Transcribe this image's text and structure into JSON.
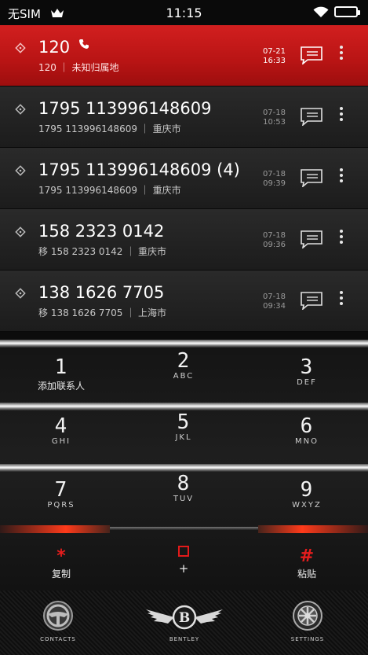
{
  "status_bar": {
    "carrier": "无SIM",
    "time": "11:15"
  },
  "calls": [
    {
      "number": "120",
      "sub": "120 ｜ 未知归属地",
      "date": "07-21",
      "time": "16:33",
      "active": true
    },
    {
      "number": "1795 113996148609",
      "sub": "1795 113996148609 ｜ 重庆市",
      "date": "07-18",
      "time": "10:53"
    },
    {
      "number": "1795 113996148609 (4)",
      "sub": "1795 113996148609 ｜ 重庆市",
      "date": "07-18",
      "time": "09:39"
    },
    {
      "number": "158 2323 0142",
      "sub": "移 158 2323 0142 ｜ 重庆市",
      "date": "07-18",
      "time": "09:36"
    },
    {
      "number": "138 1626 7705",
      "sub": "移 138 1626 7705 ｜ 上海市",
      "date": "07-18",
      "time": "09:34"
    }
  ],
  "keypad": {
    "keys": [
      {
        "digit": "1",
        "letters": "",
        "caption": "添加联系人"
      },
      {
        "digit": "2",
        "letters": "ABC"
      },
      {
        "digit": "3",
        "letters": "DEF"
      },
      {
        "digit": "4",
        "letters": "GHI"
      },
      {
        "digit": "5",
        "letters": "JKL"
      },
      {
        "digit": "6",
        "letters": "MNO"
      },
      {
        "digit": "7",
        "letters": "PQRS"
      },
      {
        "digit": "8",
        "letters": "TUV"
      },
      {
        "digit": "9",
        "letters": "WXYZ"
      }
    ],
    "star": {
      "symbol": "*",
      "caption": "复制"
    },
    "zero": {
      "symbol": "+"
    },
    "hash": {
      "symbol": "#",
      "caption": "粘贴"
    }
  },
  "tabbar": {
    "contacts": "CONTACTS",
    "brand": "BENTLEY",
    "brand_letter": "B",
    "settings": "SETTINGS"
  },
  "icons": {
    "crown": "crown-icon",
    "wifi": "wifi-icon",
    "battery": "battery-icon",
    "phone": "phone-icon",
    "tag": "diamond-tag-icon",
    "message": "message-icon",
    "more": "more-vertical-icon",
    "steering": "steering-wheel-icon",
    "wheel": "wheel-icon",
    "logo": "winged-b-logo"
  },
  "colors": {
    "accent_red": "#d21f1f",
    "background": "#0c0c0c"
  }
}
